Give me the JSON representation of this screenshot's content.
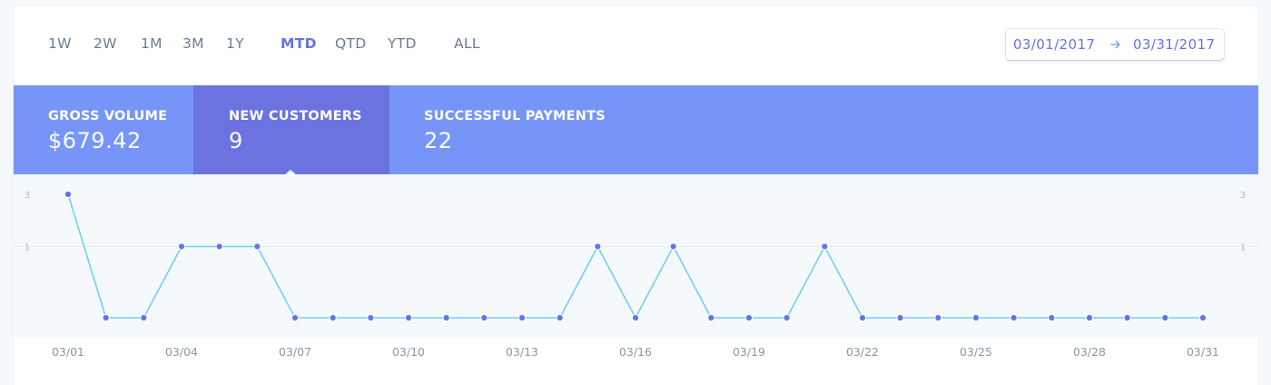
{
  "range_tabs": [
    {
      "label": "1W",
      "active": false
    },
    {
      "label": "2W",
      "active": false
    },
    {
      "label": "1M",
      "active": false
    },
    {
      "label": "3M",
      "active": false
    },
    {
      "label": "1Y",
      "active": false
    },
    {
      "label": "MTD",
      "active": true
    },
    {
      "label": "QTD",
      "active": false
    },
    {
      "label": "YTD",
      "active": false
    },
    {
      "label": "ALL",
      "active": false
    }
  ],
  "date_range": {
    "start": "03/01/2017",
    "end": "03/31/2017"
  },
  "metrics": [
    {
      "label": "GROSS VOLUME",
      "value": "$679.42",
      "active": false
    },
    {
      "label": "NEW CUSTOMERS",
      "value": "9",
      "active": true
    },
    {
      "label": "SUCCESSFUL PAYMENTS",
      "value": "22",
      "active": false
    }
  ],
  "colors": {
    "accent": "#6772e5",
    "metrics_bg": "#7795f8",
    "metrics_active_bg": "#6b73e0",
    "line": "#6ed3ee",
    "point": "#6772e5"
  },
  "chart_data": {
    "type": "line",
    "x": [
      "03/01",
      "03/02",
      "03/03",
      "03/04",
      "03/05",
      "03/06",
      "03/07",
      "03/08",
      "03/09",
      "03/10",
      "03/11",
      "03/12",
      "03/13",
      "03/14",
      "03/15",
      "03/16",
      "03/17",
      "03/18",
      "03/19",
      "03/20",
      "03/21",
      "03/22",
      "03/23",
      "03/24",
      "03/25",
      "03/26",
      "03/27",
      "03/28",
      "03/29",
      "03/30",
      "03/31"
    ],
    "values": [
      3,
      0,
      0,
      1,
      1,
      1,
      0,
      0,
      0,
      0,
      0,
      0,
      0,
      0,
      1,
      0,
      1,
      0,
      0,
      0,
      1,
      0,
      0,
      0,
      0,
      0,
      0,
      0,
      0,
      0,
      0
    ],
    "x_tick_labels": [
      "03/01",
      "03/04",
      "03/07",
      "03/10",
      "03/13",
      "03/16",
      "03/19",
      "03/22",
      "03/25",
      "03/28",
      "03/31"
    ],
    "y_tick_labels": [
      "3",
      "1"
    ],
    "y_ticks": [
      3,
      1
    ],
    "grid": true,
    "scale": "sqrt"
  }
}
